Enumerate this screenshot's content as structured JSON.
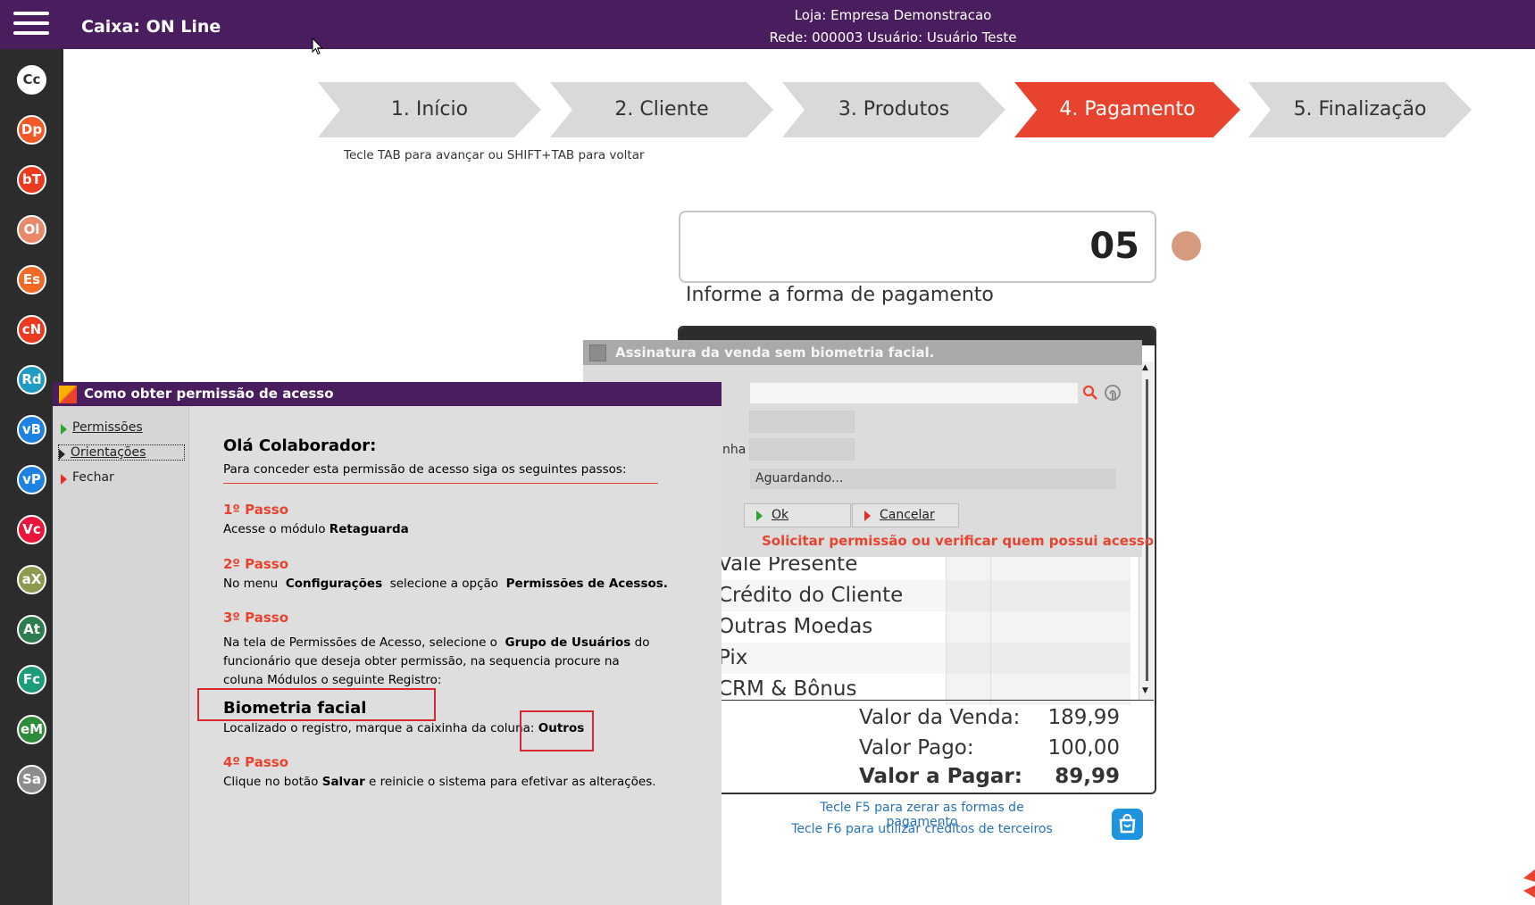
{
  "header": {
    "app_title": "Caixa: ON Line",
    "store_line": "Loja: Empresa Demonstracao",
    "user_line": "Rede: 000003 Usuário: Usuário Teste"
  },
  "shortcuts": [
    {
      "code": "Cc",
      "color": "#ffffff",
      "text_color": "#333333"
    },
    {
      "code": "Dp",
      "color": "#f05a28",
      "text_color": "#ffffff"
    },
    {
      "code": "bT",
      "color": "#ea3a1f",
      "text_color": "#ffffff"
    },
    {
      "code": "Ol",
      "color": "#e9896a",
      "text_color": "#ffffff"
    },
    {
      "code": "Es",
      "color": "#f06a26",
      "text_color": "#ffffff"
    },
    {
      "code": "cN",
      "color": "#ea3a1f",
      "text_color": "#ffffff"
    },
    {
      "code": "Rd",
      "color": "#1f9bc2",
      "text_color": "#ffffff"
    },
    {
      "code": "vB",
      "color": "#1e83e0",
      "text_color": "#ffffff"
    },
    {
      "code": "vP",
      "color": "#1e83e0",
      "text_color": "#ffffff"
    },
    {
      "code": "Vc",
      "color": "#e9153a",
      "text_color": "#ffffff"
    },
    {
      "code": "aX",
      "color": "#8c9a4e",
      "text_color": "#ffffff"
    },
    {
      "code": "At",
      "color": "#2e7d4f",
      "text_color": "#ffffff"
    },
    {
      "code": "Fc",
      "color": "#1c9c7a",
      "text_color": "#ffffff"
    },
    {
      "code": "eM",
      "color": "#2e8b3a",
      "text_color": "#ffffff"
    },
    {
      "code": "Sa",
      "color": "#8c8c8c",
      "text_color": "#ffffff"
    }
  ],
  "steps": [
    {
      "label": "1. Início",
      "active": false
    },
    {
      "label": "2. Cliente",
      "active": false
    },
    {
      "label": "3. Produtos",
      "active": false
    },
    {
      "label": "4. Pagamento",
      "active": true
    },
    {
      "label": "5. Finalização",
      "active": false
    }
  ],
  "steps_hint": "Tecle TAB para avançar ou SHIFT+TAB para voltar",
  "payment": {
    "input_value": "05",
    "prompt": "Informe a forma de pagamento",
    "rows": [
      "Vale Presente",
      "Crédito do Cliente",
      "Outras Moedas",
      "Pix",
      "CRM & Bônus"
    ],
    "sale_label": "Valor da Venda:",
    "sale_value": "189,99",
    "paid_label": "Valor Pago:",
    "paid_value": "100,00",
    "due_label": "Valor a Pagar:",
    "due_value": "89,99",
    "f5_hint": "Tecle F5 para zerar as formas de pagamento",
    "f6_hint": "Tecle F6 para utilizar créditos de terceiros"
  },
  "signature_dialog": {
    "title": "Assinatura da venda sem biometria facial.",
    "password_label_fragment": "nha",
    "status": "Aguardando...",
    "ok": "Ok",
    "cancel": "Cancelar",
    "permission_link": "Solicitar permissão ou verificar quem possui acesso"
  },
  "help_dialog": {
    "title": "Como obter permissão de acesso",
    "nav": [
      "Permissões",
      "Orientações",
      "Fechar"
    ],
    "greeting": "Olá Colaborador:",
    "intro": "Para conceder esta permissão de acesso siga os seguintes passos:",
    "step1_title": "1º Passo",
    "step1_text": "Acesse o módulo",
    "step1_bold": "Retaguarda",
    "step2_title": "2º Passo",
    "step2_pre": "No menu",
    "step2_b1": "Configurações",
    "step2_mid": "selecione a opção",
    "step2_b2": "Permissões de Acessos.",
    "step3_title": "3º Passo",
    "step3_pre": "Na tela de Permissões de Acesso, selecione o",
    "step3_b1": "Grupo de Usuários",
    "step3_post": "do",
    "step3_line2": "funcionário que deseja obter permissão, na sequencia procure na",
    "step3_line3": "coluna Módulos o seguinte Registro:",
    "registry": "Biometria facial",
    "mark_pre": "Localizado o registro, marque a caixinha da coluna:",
    "mark_bold": "Outros",
    "step4_title": "4º Passo",
    "step4_pre": "Clique no botão",
    "step4_b": "Salvar",
    "step4_post": "e reinicie o sistema para efetivar as alterações."
  },
  "colors": {
    "brand": "#4a1e5e",
    "accent": "#e8432e",
    "link": "#2673b8"
  }
}
